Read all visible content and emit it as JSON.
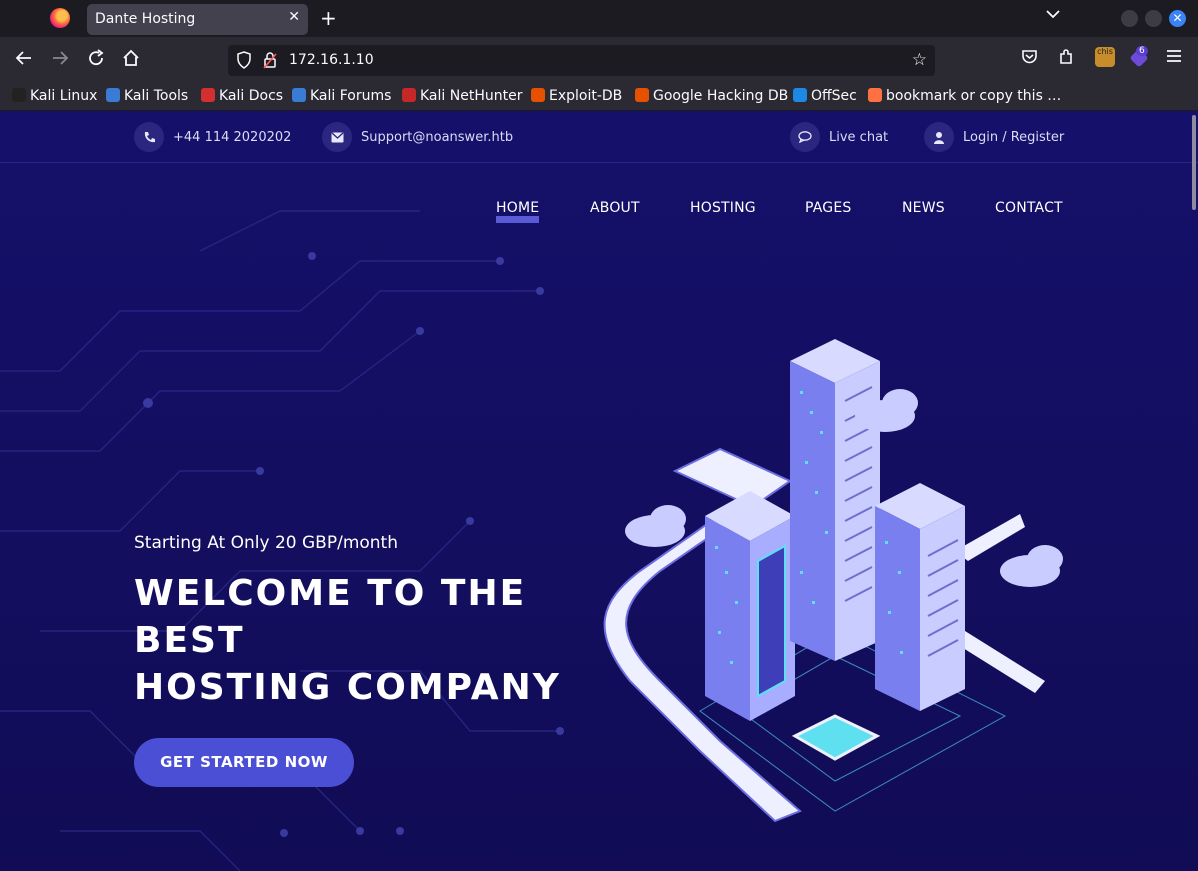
{
  "browser": {
    "tab_title": "Dante Hosting",
    "tab_close": "✕",
    "new_tab": "+",
    "url": "172.16.1.10",
    "ext_badge_text": "chis",
    "ext_count": "6",
    "bookmarks": [
      {
        "label": "Kali Linux",
        "color": "#222222"
      },
      {
        "label": "Kali Tools",
        "color": "#3a7bd5"
      },
      {
        "label": "Kali Docs",
        "color": "#d32f2f"
      },
      {
        "label": "Kali Forums",
        "color": "#3a7bd5"
      },
      {
        "label": "Kali NetHunter",
        "color": "#c62828"
      },
      {
        "label": "Exploit-DB",
        "color": "#e65100"
      },
      {
        "label": "Google Hacking DB",
        "color": "#e65100"
      },
      {
        "label": "OffSec",
        "color": "#1e88e5"
      },
      {
        "label": "bookmark or copy this …",
        "color": "#ff7043"
      }
    ]
  },
  "site": {
    "phone": "+44 114 2020202",
    "email": "Support@noanswer.htb",
    "live_chat": "Live chat",
    "login": "Login / Register",
    "menu": [
      {
        "label": "HOME",
        "active": true
      },
      {
        "label": "ABOUT",
        "active": false
      },
      {
        "label": "HOSTING",
        "active": false
      },
      {
        "label": "PAGES",
        "active": false
      },
      {
        "label": "NEWS",
        "active": false
      },
      {
        "label": "CONTACT",
        "active": false
      }
    ],
    "hero": {
      "subtitle": "Starting At Only 20 GBP/month",
      "headline_line1": "WELCOME TO THE",
      "headline_line2": "BEST",
      "headline_line3": "HOSTING COMPANY",
      "cta": "GET STARTED NOW"
    }
  },
  "colors": {
    "page_bg": "#15106a",
    "accent": "#4b4fd6",
    "browser_bg": "#1c1b22"
  }
}
